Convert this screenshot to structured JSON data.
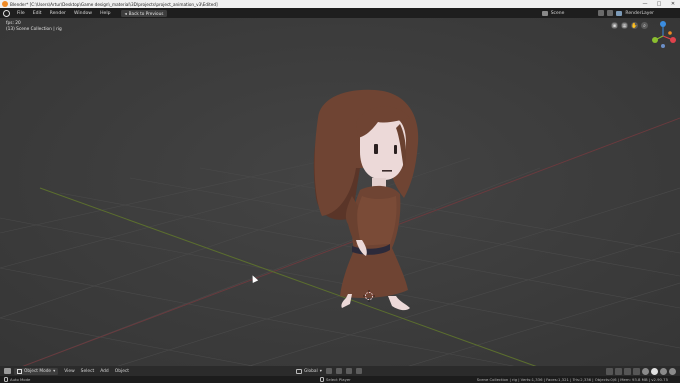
{
  "titlebar": {
    "title": "Blender* [C:\\Users\\Artur\\Desktop\\Game design\\_material\\3D\\projects\\project_animation_v3\\Edited]",
    "controls": [
      "—",
      "□",
      "✕"
    ]
  },
  "menubar": {
    "items": [
      "File",
      "Edit",
      "Render",
      "Window",
      "Help"
    ],
    "back_label": "Back to Previous",
    "scene_label": "Scene",
    "view_layer_label": "RenderLayer"
  },
  "viewport": {
    "info_line1": "fps: 20",
    "info_line2": "(13) Scene Collection | rig",
    "gizmo": {
      "x_color": "#e0424c",
      "y_color": "#8bbf2f",
      "z_color": "#3b8de0"
    }
  },
  "header": {
    "mode_label": "Object Mode",
    "menus": [
      "View",
      "Select",
      "Add",
      "Object"
    ],
    "orientation_label": "Global"
  },
  "statusbar": {
    "left_label": "Auto Mode",
    "mid_label": "Select Player",
    "stats": "Scene Collection | rig | Verts:1,336 | Faces:1,321 | Tris:2,336 | Objects:0/6 | Mem: 93.8 MB | v2.90.75"
  },
  "colors": {
    "background": "#3d3d3d",
    "character_brown": "#6f4433"
  }
}
